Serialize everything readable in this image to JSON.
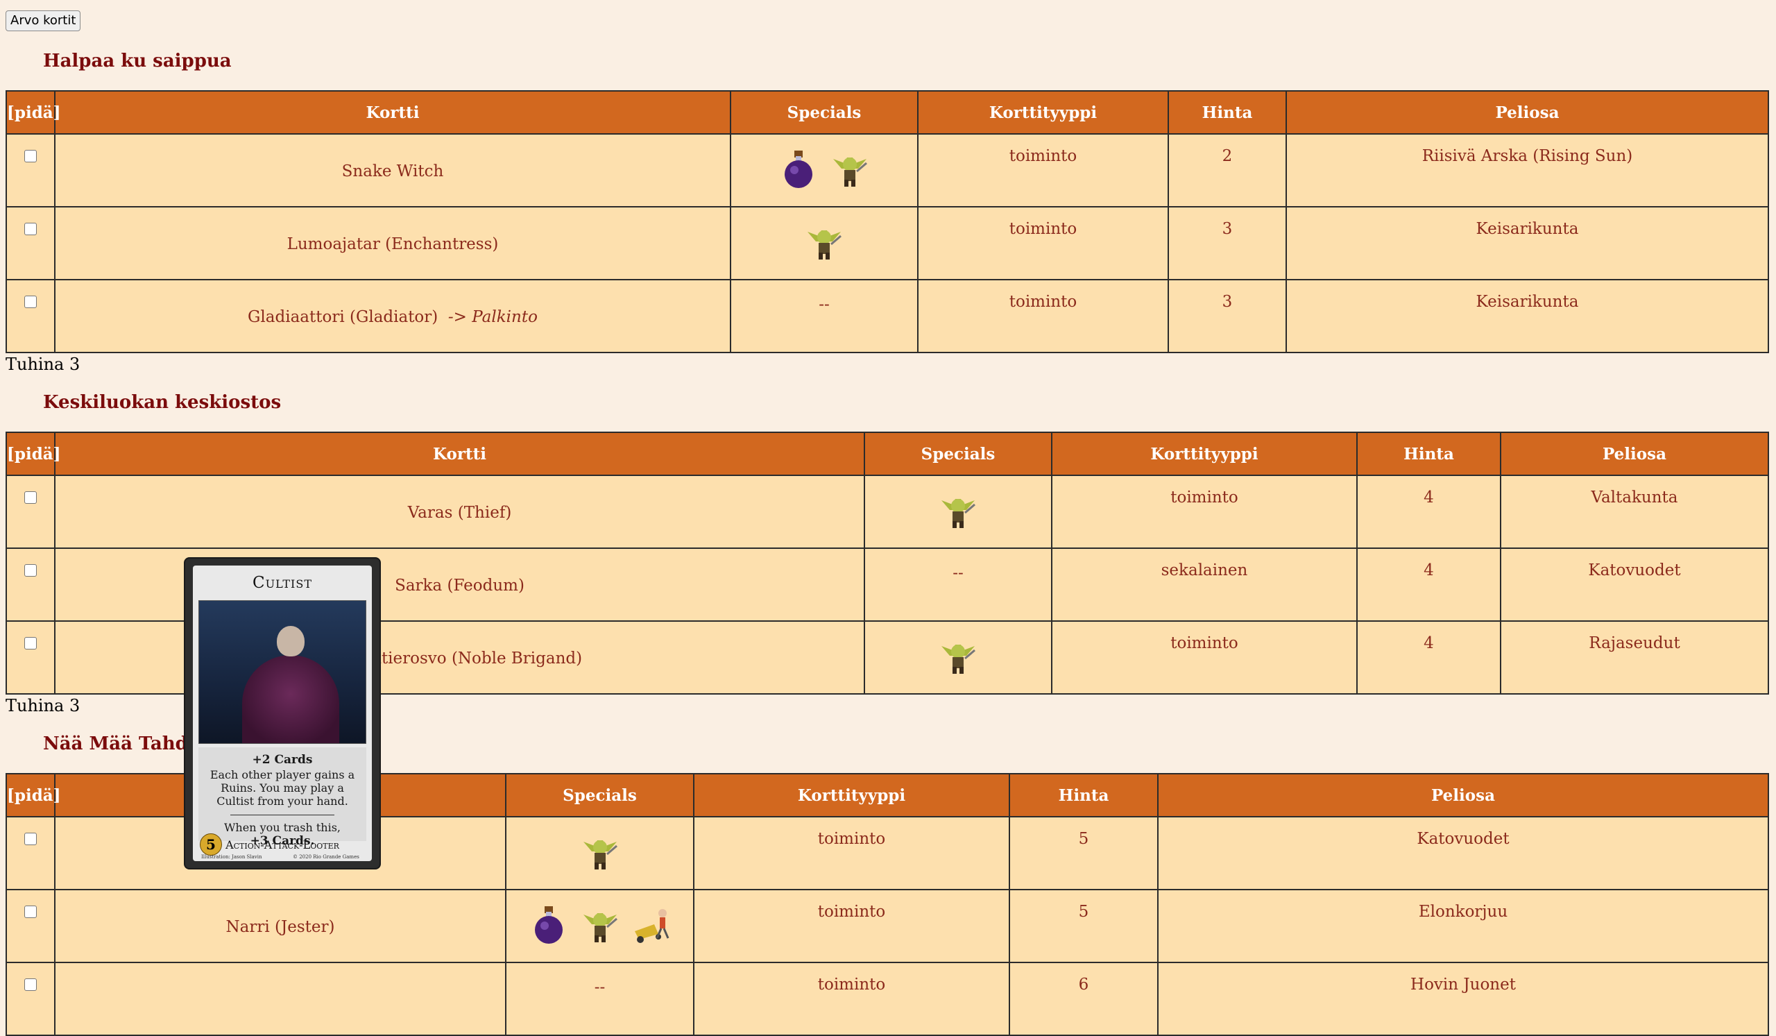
{
  "button": {
    "label": "Arvo kortit"
  },
  "columns": [
    "[pidä]",
    "Kortti",
    "Specials",
    "Korttityyppi",
    "Hinta",
    "Peliosa"
  ],
  "sections": [
    {
      "title": "Halpaa ku saippua",
      "rows": [
        {
          "card": "Snake Witch",
          "prize": "",
          "specials": [
            "potion-icon",
            "goblin-icon"
          ],
          "type": "toiminto",
          "cost": "2",
          "set": "Riisivä Arska (Rising Sun)"
        },
        {
          "card": "Lumoajatar (Enchantress)",
          "prize": "",
          "specials": [
            "goblin-icon"
          ],
          "type": "toiminto",
          "cost": "3",
          "set": "Keisarikunta"
        },
        {
          "card": "Gladiaattori (Gladiator)",
          "prize": "-> Palkinto",
          "specials": [],
          "specials_text": "--",
          "type": "toiminto",
          "cost": "3",
          "set": "Keisarikunta"
        }
      ],
      "footer": "Tuhina 3"
    },
    {
      "title": "Keskiluokan keskiostos",
      "rows": [
        {
          "card": "Varas (Thief)",
          "prize": "",
          "specials": [
            "goblin-icon"
          ],
          "type": "toiminto",
          "cost": "4",
          "set": "Valtakunta"
        },
        {
          "card": "Sarka (Feodum)",
          "prize": "",
          "specials": [],
          "specials_text": "--",
          "type": "sekalainen",
          "cost": "4",
          "set": "Katovuodet"
        },
        {
          "card": "maantierosvo (Noble Brigand)",
          "prize": "",
          "specials": [
            "goblin-icon"
          ],
          "type": "toiminto",
          "cost": "4",
          "set": "Rajaseudut"
        }
      ],
      "footer": "Tuhina 3"
    },
    {
      "title": "Nää Mää Tahdon",
      "rows": [
        {
          "card": "",
          "prize": "",
          "specials": [
            "goblin-icon"
          ],
          "type": "toiminto",
          "cost": "5",
          "set": "Katovuodet"
        },
        {
          "card": "Narri (Jester)",
          "prize": "",
          "specials": [
            "potion-icon",
            "goblin-icon",
            "cart-icon"
          ],
          "type": "toiminto",
          "cost": "5",
          "set": "Elonkorjuu"
        },
        {
          "card": "",
          "prize": "",
          "specials": [],
          "specials_text": "--",
          "type": "toiminto",
          "cost": "6",
          "set": "Hovin Juonet"
        }
      ]
    }
  ],
  "card_popup": {
    "name": "Cultist",
    "bonus": "+2 Cards",
    "text1": "Each other player gains a Ruins. You may play a Cultist from your hand.",
    "text2": "When you trash this,",
    "text2b": "+3 Cards.",
    "cost": "5",
    "types": "Action-Attack-Looter",
    "illustrator": "Illustration: Jason Slavin",
    "copyright": "© 2020 Rio Grande Games"
  }
}
